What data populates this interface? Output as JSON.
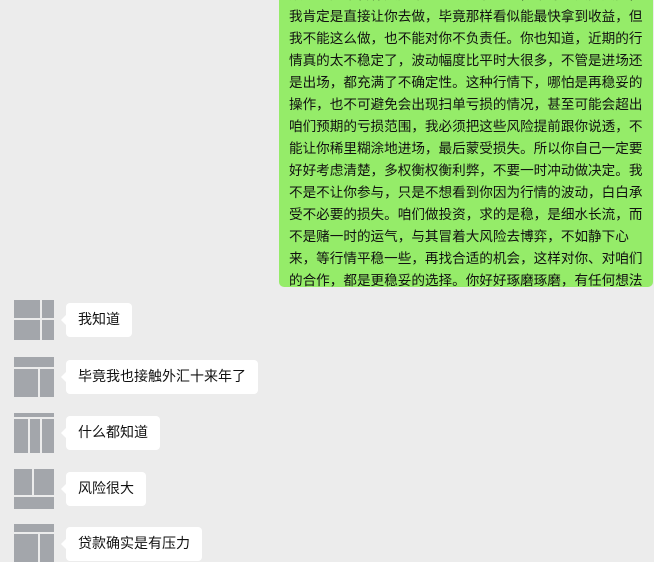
{
  "chat": {
    "outgoing_text": "放心。如果合作只是单纯为了追求利益，不考虑实际风险，我肯定是直接让你去做，毕竟那样看似能最快拿到收益，但我不能这么做，也不能对你不负责任。你也知道，近期的行情真的太不稳定了，波动幅度比平时大很多，不管是进场还是出场，都充满了不确定性。这种行情下，哪怕是再稳妥的操作，也不可避免会出现扫单亏损的情况，甚至可能会超出咱们预期的亏损范围，我必须把这些风险提前跟你说透，不能让你稀里糊涂地进场，最后蒙受损失。所以你自己一定要好好考虑清楚，多权衡权衡利弊，不要一时冲动做决定。我不是不让你参与，只是不想看到你因为行情的波动，白白承受不必要的损失。咱们做投资，求的是稳，是细水长流，而不是赌一时的运气，与其冒着大风险去博弈，不如静下心来，等行情平稳一些，再找合适的机会，这样对你、对咱们的合作，都是更稳妥的选择。你好好琢磨琢磨，有任何想法也可以随时跟我说。",
    "incoming": [
      {
        "text": "我知道"
      },
      {
        "text": "毕竟我也接触外汇十来年了"
      },
      {
        "text": "什么都知道"
      },
      {
        "text": "风险很大"
      },
      {
        "text": "贷款确实是有压力"
      }
    ]
  },
  "colors": {
    "background": "#ececec",
    "outgoing_bubble": "#95ec69",
    "incoming_bubble": "#ffffff",
    "avatar": "#a3a6ab"
  },
  "icons": {
    "avatar": "avatar-placeholder-icon"
  }
}
